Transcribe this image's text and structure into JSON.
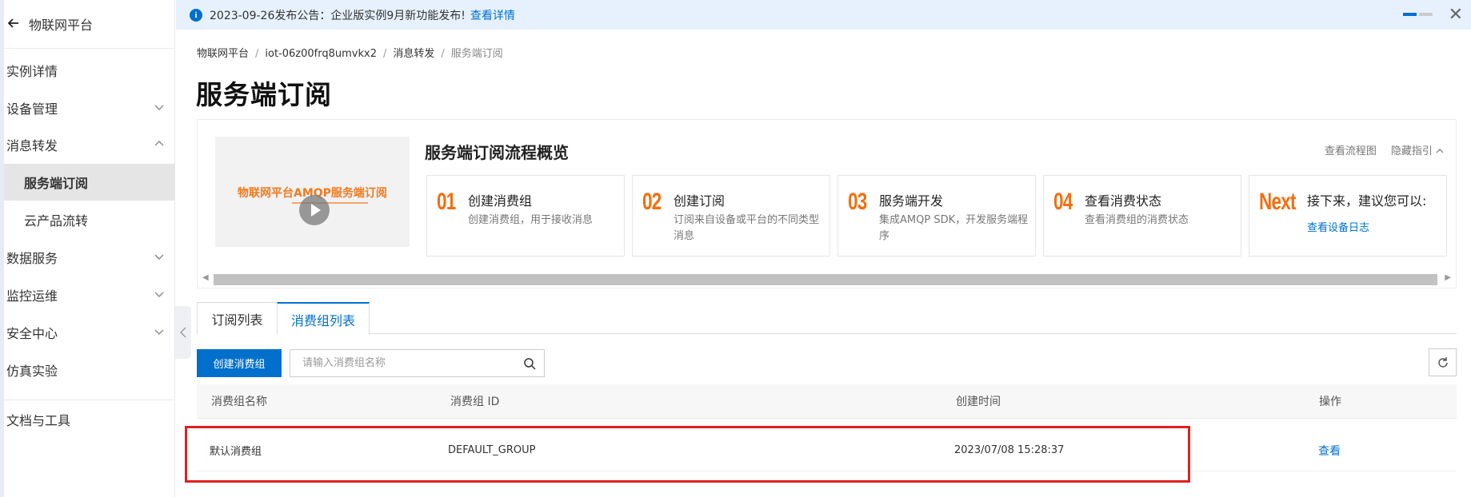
{
  "sidebar": {
    "title": "物联网平台",
    "items": [
      {
        "label": "实例详情"
      },
      {
        "label": "设备管理"
      },
      {
        "label": "消息转发"
      },
      {
        "label": "服务端订阅"
      },
      {
        "label": "云产品流转"
      },
      {
        "label": "数据服务"
      },
      {
        "label": "监控运维"
      },
      {
        "label": "安全中心"
      },
      {
        "label": "仿真实验"
      },
      {
        "label": "文档与工具"
      }
    ]
  },
  "notice": {
    "text": "2023-09-26发布公告：企业版实例9月新功能发布!",
    "link": "查看详情"
  },
  "breadcrumb": [
    "物联网平台",
    "iot-06z00frq8umvkx2",
    "消息转发",
    "服务端订阅"
  ],
  "page_title": "服务端订阅",
  "guide": {
    "video_title": "物联网平台AMQP服务端订阅",
    "title": "服务端订阅流程概览",
    "view_flowchart": "查看流程图",
    "hide_guide": "隐藏指引",
    "steps": [
      {
        "num": "01",
        "title": "创建消费组",
        "desc": "创建消费组，用于接收消息"
      },
      {
        "num": "02",
        "title": "创建订阅",
        "desc": "订阅来自设备或平台的不同类型消息"
      },
      {
        "num": "03",
        "title": "服务端开发",
        "desc": "集成AMQP SDK，开发服务端程序"
      },
      {
        "num": "04",
        "title": "查看消费状态",
        "desc": "查看消费组的消费状态"
      },
      {
        "num": "Next",
        "title": "接下来，建议您可以:",
        "link": "查看设备日志"
      }
    ]
  },
  "tabs": [
    {
      "label": "订阅列表",
      "active": false
    },
    {
      "label": "消费组列表",
      "active": true
    }
  ],
  "toolbar": {
    "create_button": "创建消费组",
    "search_placeholder": "请输入消费组名称"
  },
  "table": {
    "columns": [
      "消费组名称",
      "消费组 ID",
      "创建时间",
      "操作"
    ],
    "rows": [
      {
        "name": "默认消费组",
        "id": "DEFAULT_GROUP",
        "created": "2023/07/08 15:28:37",
        "action": "查看"
      }
    ]
  },
  "colors": {
    "accent": "#0070cc",
    "step_number": "#f46e10",
    "highlight": "#e02020"
  }
}
